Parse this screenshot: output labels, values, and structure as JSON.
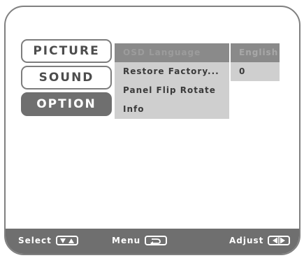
{
  "tabs": [
    {
      "label": "PICTURE",
      "active": false
    },
    {
      "label": "SOUND",
      "active": false
    },
    {
      "label": "OPTION",
      "active": true
    }
  ],
  "menu": {
    "items": [
      {
        "label": "OSD Language",
        "selected": true
      },
      {
        "label": "Restore Factory...",
        "selected": false
      },
      {
        "label": "Panel Flip Rotate",
        "selected": false
      },
      {
        "label": "Info",
        "selected": false
      }
    ],
    "values": [
      {
        "label": "English",
        "selected": true
      },
      {
        "label": "0",
        "selected": false
      }
    ]
  },
  "bottom": {
    "select_label": "Select",
    "select_icon": "down-up-arrows-icon",
    "menu_label": "Menu",
    "menu_icon": "return-arrow-icon",
    "adjust_label": "Adjust",
    "adjust_icon": "left-right-arrows-icon"
  },
  "colors": {
    "active": "#6f6f6f",
    "panel": "#cfcfcf",
    "highlight": "#8a8a8a"
  }
}
